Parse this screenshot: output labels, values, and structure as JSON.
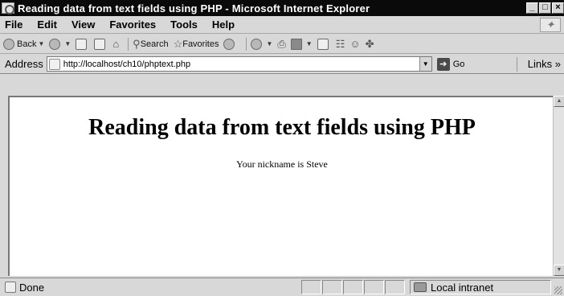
{
  "window": {
    "title": "Reading data from text fields using PHP - Microsoft Internet Explorer",
    "controls": [
      "_",
      "□",
      "×"
    ]
  },
  "menu": {
    "items": [
      "File",
      "Edit",
      "View",
      "Favorites",
      "Tools",
      "Help"
    ]
  },
  "toolbar": {
    "back_label": "Back",
    "search_label": "Search",
    "favorites_label": "Favorites"
  },
  "address": {
    "label": "Address",
    "url": "http://localhost/ch10/phptext.php",
    "go_label": "Go",
    "links_label": "Links »"
  },
  "page": {
    "heading": "Reading data from text fields using PHP",
    "message": "Your nickname is Steve"
  },
  "status": {
    "text": "Done",
    "zone": "Local intranet"
  }
}
